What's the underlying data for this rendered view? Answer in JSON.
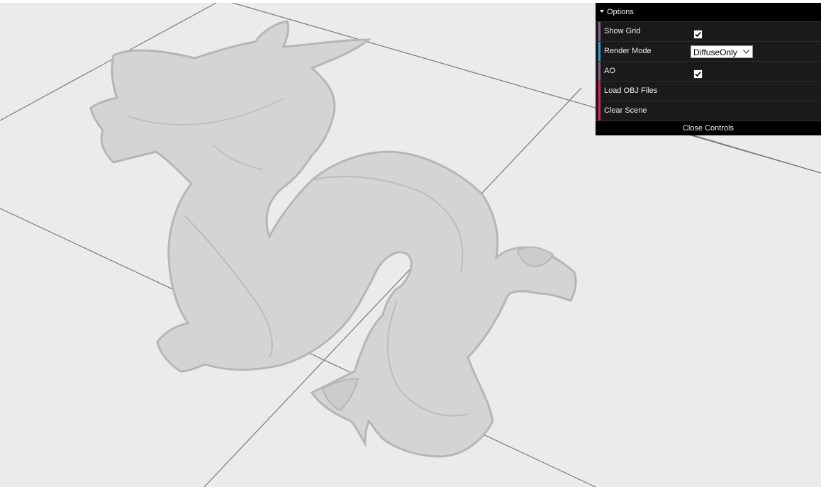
{
  "viewport": {
    "background": "#ebebeb",
    "grid_color": "#7a7a7a",
    "model_color": "#d2d2d2",
    "model_outline": "#b4b4b4"
  },
  "gui": {
    "title": "Options",
    "rows": [
      {
        "label": "Show Grid",
        "type": "checkbox",
        "checked": true,
        "accent": "#806787"
      },
      {
        "label": "Render Mode",
        "type": "select",
        "value": "DiffuseOnly",
        "accent": "#2fa1d6"
      },
      {
        "label": "AO",
        "type": "checkbox",
        "checked": true,
        "accent": "#806787"
      },
      {
        "label": "Load OBJ Files",
        "type": "function",
        "accent": "#e61d5f"
      },
      {
        "label": "Clear Scene",
        "type": "function",
        "accent": "#e61d5f"
      }
    ],
    "close_label": "Close Controls"
  }
}
